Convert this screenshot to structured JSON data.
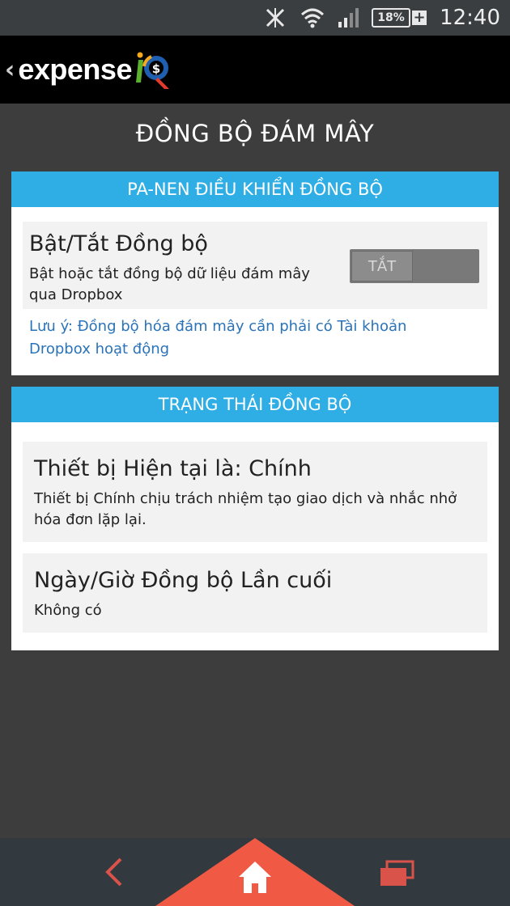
{
  "status_bar": {
    "battery_percent": "18%",
    "battery_charging": "+",
    "time": "12:40",
    "icons": [
      "no-signal-x-icon",
      "wifi-icon",
      "cell-signal-icon",
      "battery-icon"
    ]
  },
  "app_bar": {
    "back": "‹",
    "logo_text": "expense",
    "logo_suffix_icon": "iq-logo-icon"
  },
  "page": {
    "title": "ĐỒNG BỘ ĐÁM MÂY"
  },
  "sync_panel": {
    "header": "PA-NEN ĐIỀU KHIỂN ĐỒNG BỘ",
    "toggle_title": "Bật/Tắt Đồng bộ",
    "toggle_description": "Bật hoặc tắt đồng bộ dữ liệu đám mây qua Dropbox",
    "toggle_state_label": "TẮT",
    "note": "Lưu ý: Đồng bộ hóa đám mây cần phải có Tài khoản Dropbox hoạt động"
  },
  "status_panel": {
    "header": "TRẠNG THÁI ĐỒNG BỘ",
    "device_title": "Thiết bị Hiện tại là: Chính",
    "device_description": "Thiết bị Chính chịu trách nhiệm tạo giao dịch và nhắc nhở hóa đơn lặp lại.",
    "last_sync_title": "Ngày/Giờ Đồng bộ Lần cuối",
    "last_sync_value": "Không có"
  },
  "bottom_nav": {
    "icons": [
      "back-arrow-icon",
      "home-icon",
      "recent-apps-icon"
    ]
  },
  "colors": {
    "accent": "#2eaee4",
    "home_highlight": "#f05a45",
    "note_link": "#2a73b8"
  }
}
